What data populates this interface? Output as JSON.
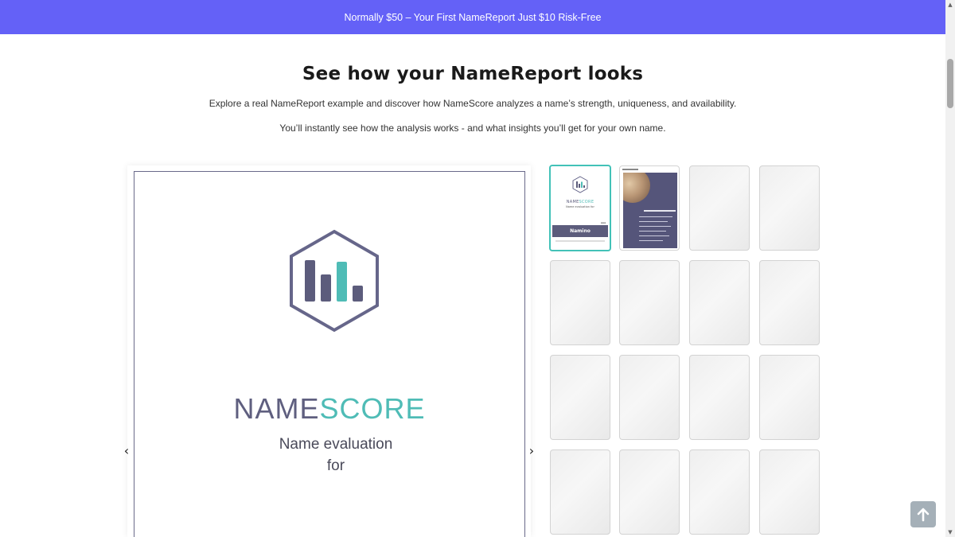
{
  "promo": {
    "text": "Normally $50 – Your First NameReport Just $10 Risk-Free"
  },
  "section": {
    "title": "See how your NameReport looks",
    "description_1": "Explore a real NameReport example and discover how NameScore analyzes a name’s strength, uniqueness, and availability.",
    "description_2": "You’ll instantly see how the analysis works - and what insights you’ll get for your own name."
  },
  "viewer": {
    "brand_part_1": "NAME",
    "brand_part_2": "SCORE",
    "eval_line_1": "Name evaluation",
    "eval_line_2": "for",
    "prev_label": "‹",
    "next_label": "›"
  },
  "thumbnails": {
    "active_name": "Namino",
    "active_brand_1": "NAME",
    "active_brand_2": "SCORE",
    "active_sub": "Name evaluation for",
    "total": 16,
    "selected_index": 0
  },
  "colors": {
    "promo_bg": "#6461f7",
    "brand_dark": "#5f5f7f",
    "brand_teal": "#4fbcb6",
    "active_border": "#43c2b8"
  },
  "icons": {
    "scroll_top": "arrow-up-icon",
    "logo": "hexagon-bar-chart-icon"
  }
}
